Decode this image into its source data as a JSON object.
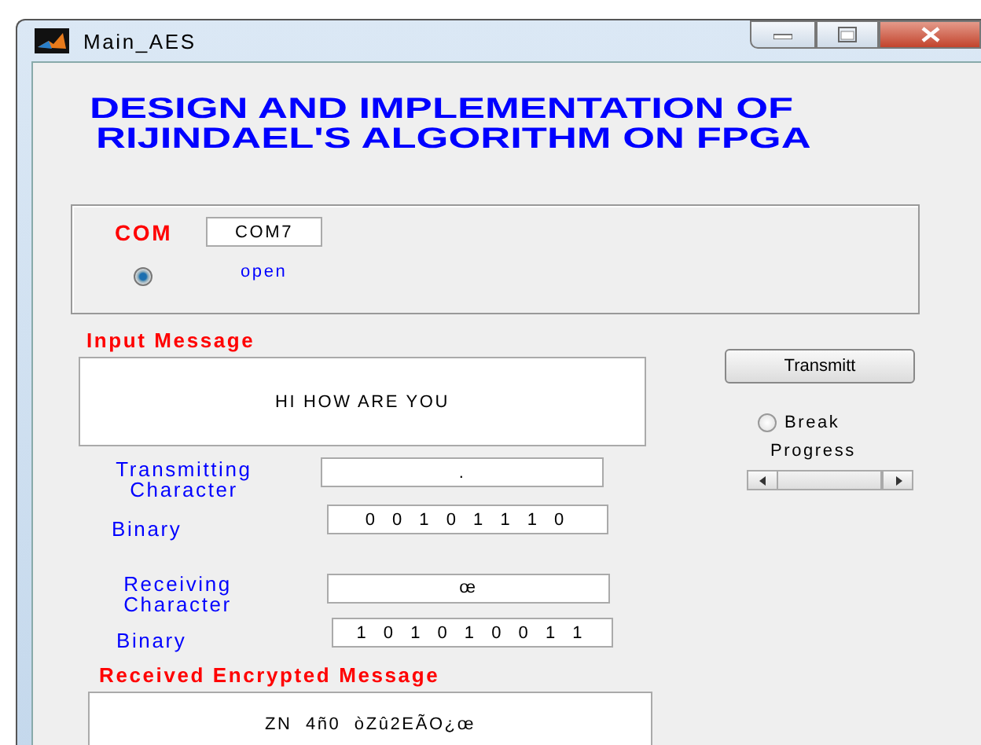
{
  "window": {
    "title": "Main_AES"
  },
  "heading": [
    "DESIGN AND IMPLEMENTATION OF",
    "RIJINDAEL'S ALGORITHM ON FPGA"
  ],
  "com_panel": {
    "label": "COM",
    "port": "COM7",
    "radio": {
      "label": "open",
      "selected": true
    }
  },
  "input_message": {
    "label": "Input Message",
    "value": "HI HOW ARE YOU"
  },
  "transmit_button": "Transmitt",
  "break_radio": {
    "label": "Break",
    "selected": false
  },
  "progress": {
    "label": "Progress"
  },
  "transmitting": {
    "label": [
      "Transmitting",
      "Character"
    ],
    "value": ".",
    "binary_label": "Binary",
    "binary": "0 0 1 0 1 1 1 0"
  },
  "receiving": {
    "label": [
      "Receiving",
      "Character"
    ],
    "value": "œ",
    "binary_label": "Binary",
    "binary": "1 0 1 0 1 0 0 1 1"
  },
  "received_message": {
    "label": "Received Encrypted Message",
    "value": "ZN  4ñ0  òZû2EÃO¿œ"
  }
}
